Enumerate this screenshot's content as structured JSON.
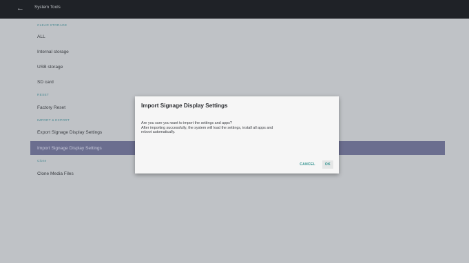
{
  "header": {
    "title": "System Tools",
    "back_icon": "arrow-left-icon"
  },
  "sections": {
    "clear_storage": {
      "label": "CLEAR STORAGE",
      "items": [
        "ALL",
        "Internal storage",
        "USB storage",
        "SD card"
      ]
    },
    "reset": {
      "label": "RESET",
      "items": [
        "Factory Reset"
      ]
    },
    "import_export": {
      "label": "IMPORT & EXPORT",
      "items": [
        "Export Signage Display Settings",
        "Import Signage Display Settings"
      ]
    },
    "clone": {
      "label": "Clone",
      "items": [
        "Clone Media Files"
      ]
    }
  },
  "dialog": {
    "title": "Import Signage Display Settings",
    "message_line1": "Are you sure you want to import the settings and apps?",
    "message_line2": "After importing successfully, the system will load the settings, install all apps and",
    "message_line3": "reboot automatically.",
    "cancel_label": "CANCEL",
    "ok_label": "OK"
  },
  "colors": {
    "topbar": "#1f2227",
    "background": "#bfc2c6",
    "selected_row": "#6b6e8f",
    "section_header": "#4d8b93",
    "dialog_accent": "#2a8f8b"
  }
}
